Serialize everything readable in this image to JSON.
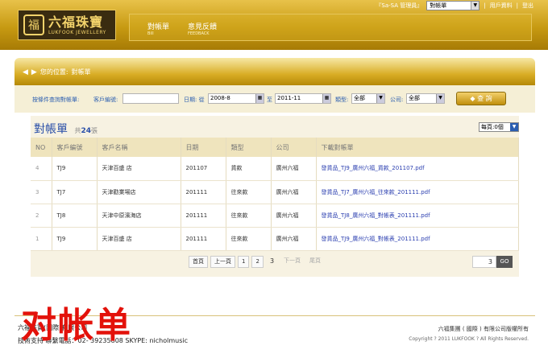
{
  "header": {
    "admin_label": "『Sa-SA 管理員』",
    "select_value": "對帳單",
    "user_info": "用戶資料",
    "logout": "登出",
    "logo_emblem": "福",
    "logo_cn": "六福珠寶",
    "logo_en": "LUKFOOK JEWELLERY",
    "nav": [
      {
        "cn": "對帳單",
        "en": "Bill"
      },
      {
        "cn": "意見反饋",
        "en": "FEEDBACK"
      }
    ]
  },
  "breadcrumb": {
    "label": "您的位置:",
    "current": "對帳單"
  },
  "filter": {
    "title": "按條件查詢對帳單:",
    "client_label": "客戶編號:",
    "client_value": "",
    "date_label": "日期: 從",
    "date_from": "2008-8",
    "date_to_label": "至",
    "date_to": "2011-11",
    "type_label": "類型:",
    "type_value": "全部",
    "company_label": "公司:",
    "company_value": "全部",
    "query_button": "查 詢"
  },
  "list": {
    "title": "對帳單",
    "count_prefix": "共",
    "count": "24",
    "count_suffix": "張",
    "per_page": "每頁:0個",
    "columns": [
      "NO",
      "客戶編號",
      "客戶名稱",
      "日期",
      "類型",
      "公司",
      "下載對帳單"
    ],
    "rows": [
      {
        "no": "4",
        "client_id": "TJ9",
        "client_name": "天津百盛 店",
        "date": "201107",
        "type": "貨款",
        "company": "廣州六福",
        "download": "發貨品_TJ9_廣州六福_貨款_201107.pdf"
      },
      {
        "no": "3",
        "client_id": "TJ7",
        "client_name": "天津勸業場店",
        "date": "201111",
        "type": "往來款",
        "company": "廣州六福",
        "download": "發貨品_TJ7_廣州六福_往來款_201111.pdf"
      },
      {
        "no": "2",
        "client_id": "TJ8",
        "client_name": "天津中原濱海店",
        "date": "201111",
        "type": "往來款",
        "company": "廣州六福",
        "download": "發貨品_TJ8_廣州六福_對帳表_201111.pdf"
      },
      {
        "no": "1",
        "client_id": "TJ9",
        "client_name": "天津百盛 店",
        "date": "201111",
        "type": "往來款",
        "company": "廣州六福",
        "download": "發貨品_TJ9_廣州六福_對帳表_201111.pdf"
      }
    ]
  },
  "pagination": {
    "first": "首頁",
    "prev": "上一頁",
    "pages": [
      "1",
      "2",
      "3"
    ],
    "current": "3",
    "next": "下一頁",
    "last": "尾頁",
    "jump_value": "3",
    "go": "GO"
  },
  "footer": {
    "left_line1": "六福珠寶(國際)有限公司",
    "left_line2": "技術支持 聯繫電話：02- 39235808    SKYPE: nicholmusic",
    "company": "六福集團 ( 國際 ) 有限公司版權所有",
    "copyright": "Copyright ? 2011 LUKFOOK ? All Rights Reserved."
  },
  "overlay_text": "对帐单",
  "colors": {
    "gold": "#c79a12",
    "link_blue": "#2b3fb0",
    "overlay_red": "#e3120b"
  }
}
